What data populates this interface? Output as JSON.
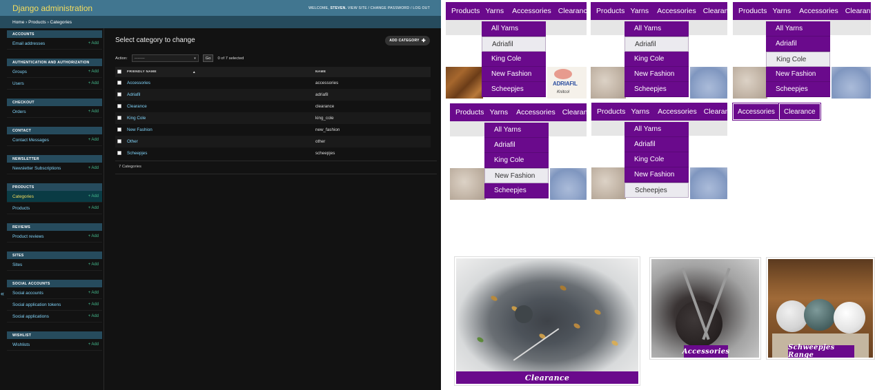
{
  "admin": {
    "brand": "Django administration",
    "user_tools": {
      "welcome": "WELCOME,",
      "user": "STEVEN.",
      "links": "VIEW SITE / CHANGE PASSWORD / LOG OUT"
    },
    "breadcrumbs": "Home › Products › Categories",
    "collapse_glyph": "«",
    "modules": [
      {
        "caption": "ACCOUNTS",
        "rows": [
          {
            "label": "Email addresses",
            "add": "Add"
          }
        ]
      },
      {
        "caption": "AUTHENTICATION AND AUTHORIZATION",
        "rows": [
          {
            "label": "Groups",
            "add": "Add"
          },
          {
            "label": "Users",
            "add": "Add"
          }
        ]
      },
      {
        "caption": "CHECKOUT",
        "rows": [
          {
            "label": "Orders",
            "add": "Add"
          }
        ]
      },
      {
        "caption": "CONTACT",
        "rows": [
          {
            "label": "Contact Messages",
            "add": "Add"
          }
        ]
      },
      {
        "caption": "NEWSLETTER",
        "rows": [
          {
            "label": "Newsletter Subscriptions",
            "add": "Add"
          }
        ]
      },
      {
        "caption": "PRODUCTS",
        "rows": [
          {
            "label": "Categories",
            "add": "Add",
            "current": true
          },
          {
            "label": "Products",
            "add": "Add"
          }
        ]
      },
      {
        "caption": "REVIEWS",
        "rows": [
          {
            "label": "Product reviews",
            "add": "Add"
          }
        ]
      },
      {
        "caption": "SITES",
        "rows": [
          {
            "label": "Sites",
            "add": "Add"
          }
        ]
      },
      {
        "caption": "SOCIAL ACCOUNTS",
        "rows": [
          {
            "label": "Social accounts",
            "add": "Add"
          },
          {
            "label": "Social application tokens",
            "add": "Add"
          },
          {
            "label": "Social applications",
            "add": "Add"
          }
        ]
      },
      {
        "caption": "WISHLIST",
        "rows": [
          {
            "label": "Wishlists",
            "add": "Add"
          }
        ]
      }
    ],
    "page_title": "Select category to change",
    "add_button": "ADD CATEGORY",
    "action_label": "Action:",
    "action_select": "---------",
    "go": "Go",
    "selected": "0 of 7 selected",
    "columns": [
      "FRIENDLY NAME",
      "NAME"
    ],
    "rows": [
      [
        "Accessories",
        "accessories"
      ],
      [
        "Adriafil",
        "adriafil"
      ],
      [
        "Clearance",
        "clearance"
      ],
      [
        "King Cole",
        "king_cole"
      ],
      [
        "New Fashion",
        "new_fashion"
      ],
      [
        "Other",
        "other"
      ],
      [
        "Scheepjes",
        "scheepjes"
      ]
    ],
    "count": "7 Categories"
  },
  "nav_items": [
    "Products",
    "Yarns",
    "Accessories",
    "Clearance"
  ],
  "dropdown_items": [
    "All Yarns",
    "Adriafil",
    "King Cole",
    "New Fashion",
    "Scheepjes"
  ],
  "brand_label": {
    "name": "ADRIAFIL",
    "sub": "Knitcol"
  },
  "pills": [
    "Accessories",
    "Clearance"
  ],
  "cards": [
    "Clearance",
    "Accessories",
    "Schweepjes Range"
  ],
  "colors": {
    "purple": "#6a0a8c",
    "admin_header": "#417690",
    "admin_bg": "#121212",
    "link": "#81d4fa",
    "brand_yellow": "#f5dd5d"
  }
}
